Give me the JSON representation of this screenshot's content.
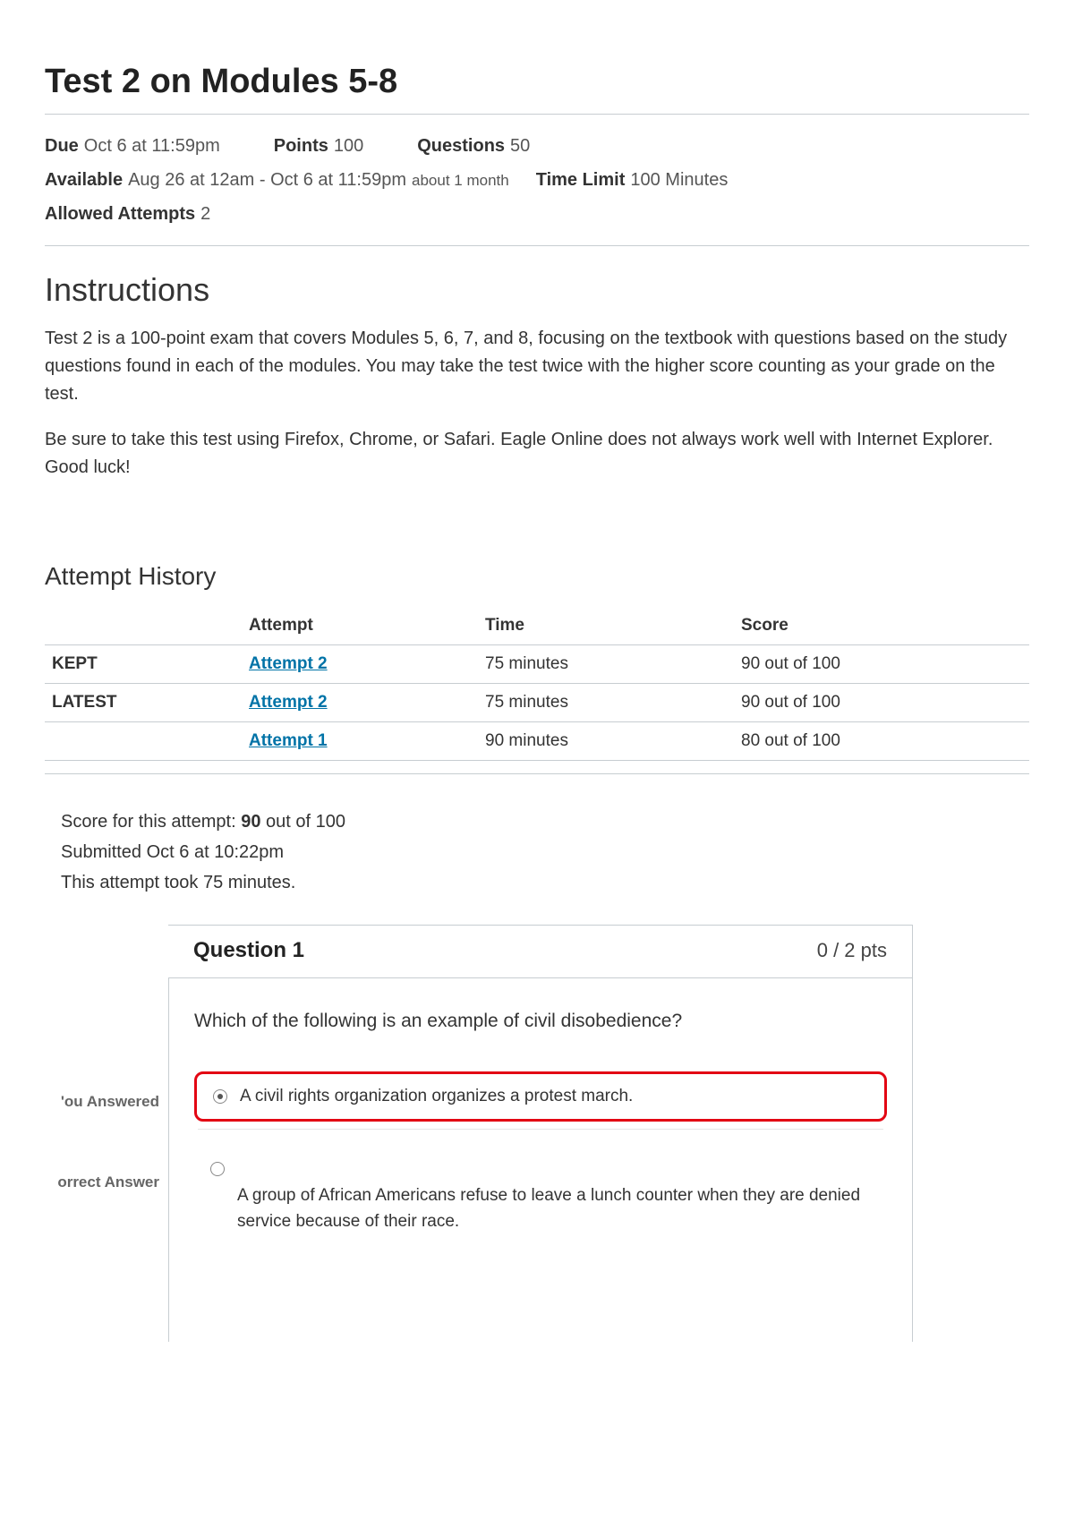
{
  "title": "Test 2 on Modules 5-8",
  "meta": {
    "due_label": "Due",
    "due_value": "Oct 6 at 11:59pm",
    "points_label": "Points",
    "points_value": "100",
    "questions_label": "Questions",
    "questions_value": "50",
    "available_label": "Available",
    "available_value": "Aug 26 at 12am - Oct 6 at 11:59pm",
    "available_hint": "about 1 month",
    "timelimit_label": "Time Limit",
    "timelimit_value": "100 Minutes",
    "attempts_label": "Allowed Attempts",
    "attempts_value": "2"
  },
  "instructions_heading": "Instructions",
  "instructions_p1": "Test 2 is a 100-point exam that covers Modules 5, 6, 7, and 8, focusing on the textbook with questions based on the study questions found in each of the modules. You may take the test twice with the higher score counting as your grade on the test.",
  "instructions_p2": "Be sure to take this test using Firefox, Chrome, or Safari.  Eagle Online does not always work well with Internet Explorer.  Good luck!",
  "history": {
    "heading": "Attempt History",
    "columns": {
      "blank": "",
      "attempt": "Attempt",
      "time": "Time",
      "score": "Score"
    },
    "rows": [
      {
        "status": "KEPT",
        "attempt": "Attempt 2",
        "time": "75 minutes",
        "score": "90 out of 100"
      },
      {
        "status": "LATEST",
        "attempt": "Attempt 2",
        "time": "75 minutes",
        "score": "90 out of 100"
      },
      {
        "status": "",
        "attempt": "Attempt 1",
        "time": "90 minutes",
        "score": "80 out of 100"
      }
    ]
  },
  "score_summary": {
    "line1_prefix": "Score for this attempt: ",
    "line1_score": "90",
    "line1_suffix": " out of 100",
    "line2": "Submitted Oct 6 at 10:22pm",
    "line3": "This attempt took 75 minutes."
  },
  "question": {
    "label": "Question 1",
    "points": "0 / 2 pts",
    "prompt": "Which of the following is an example of civil disobedience?",
    "you_answered_label": "'ou Answered",
    "selected_answer": "A civil rights organization organizes a protest march.",
    "correct_label": "orrect Answer",
    "correct_answer": "A group of African Americans refuse to leave a lunch counter when they are denied service because of their race."
  }
}
